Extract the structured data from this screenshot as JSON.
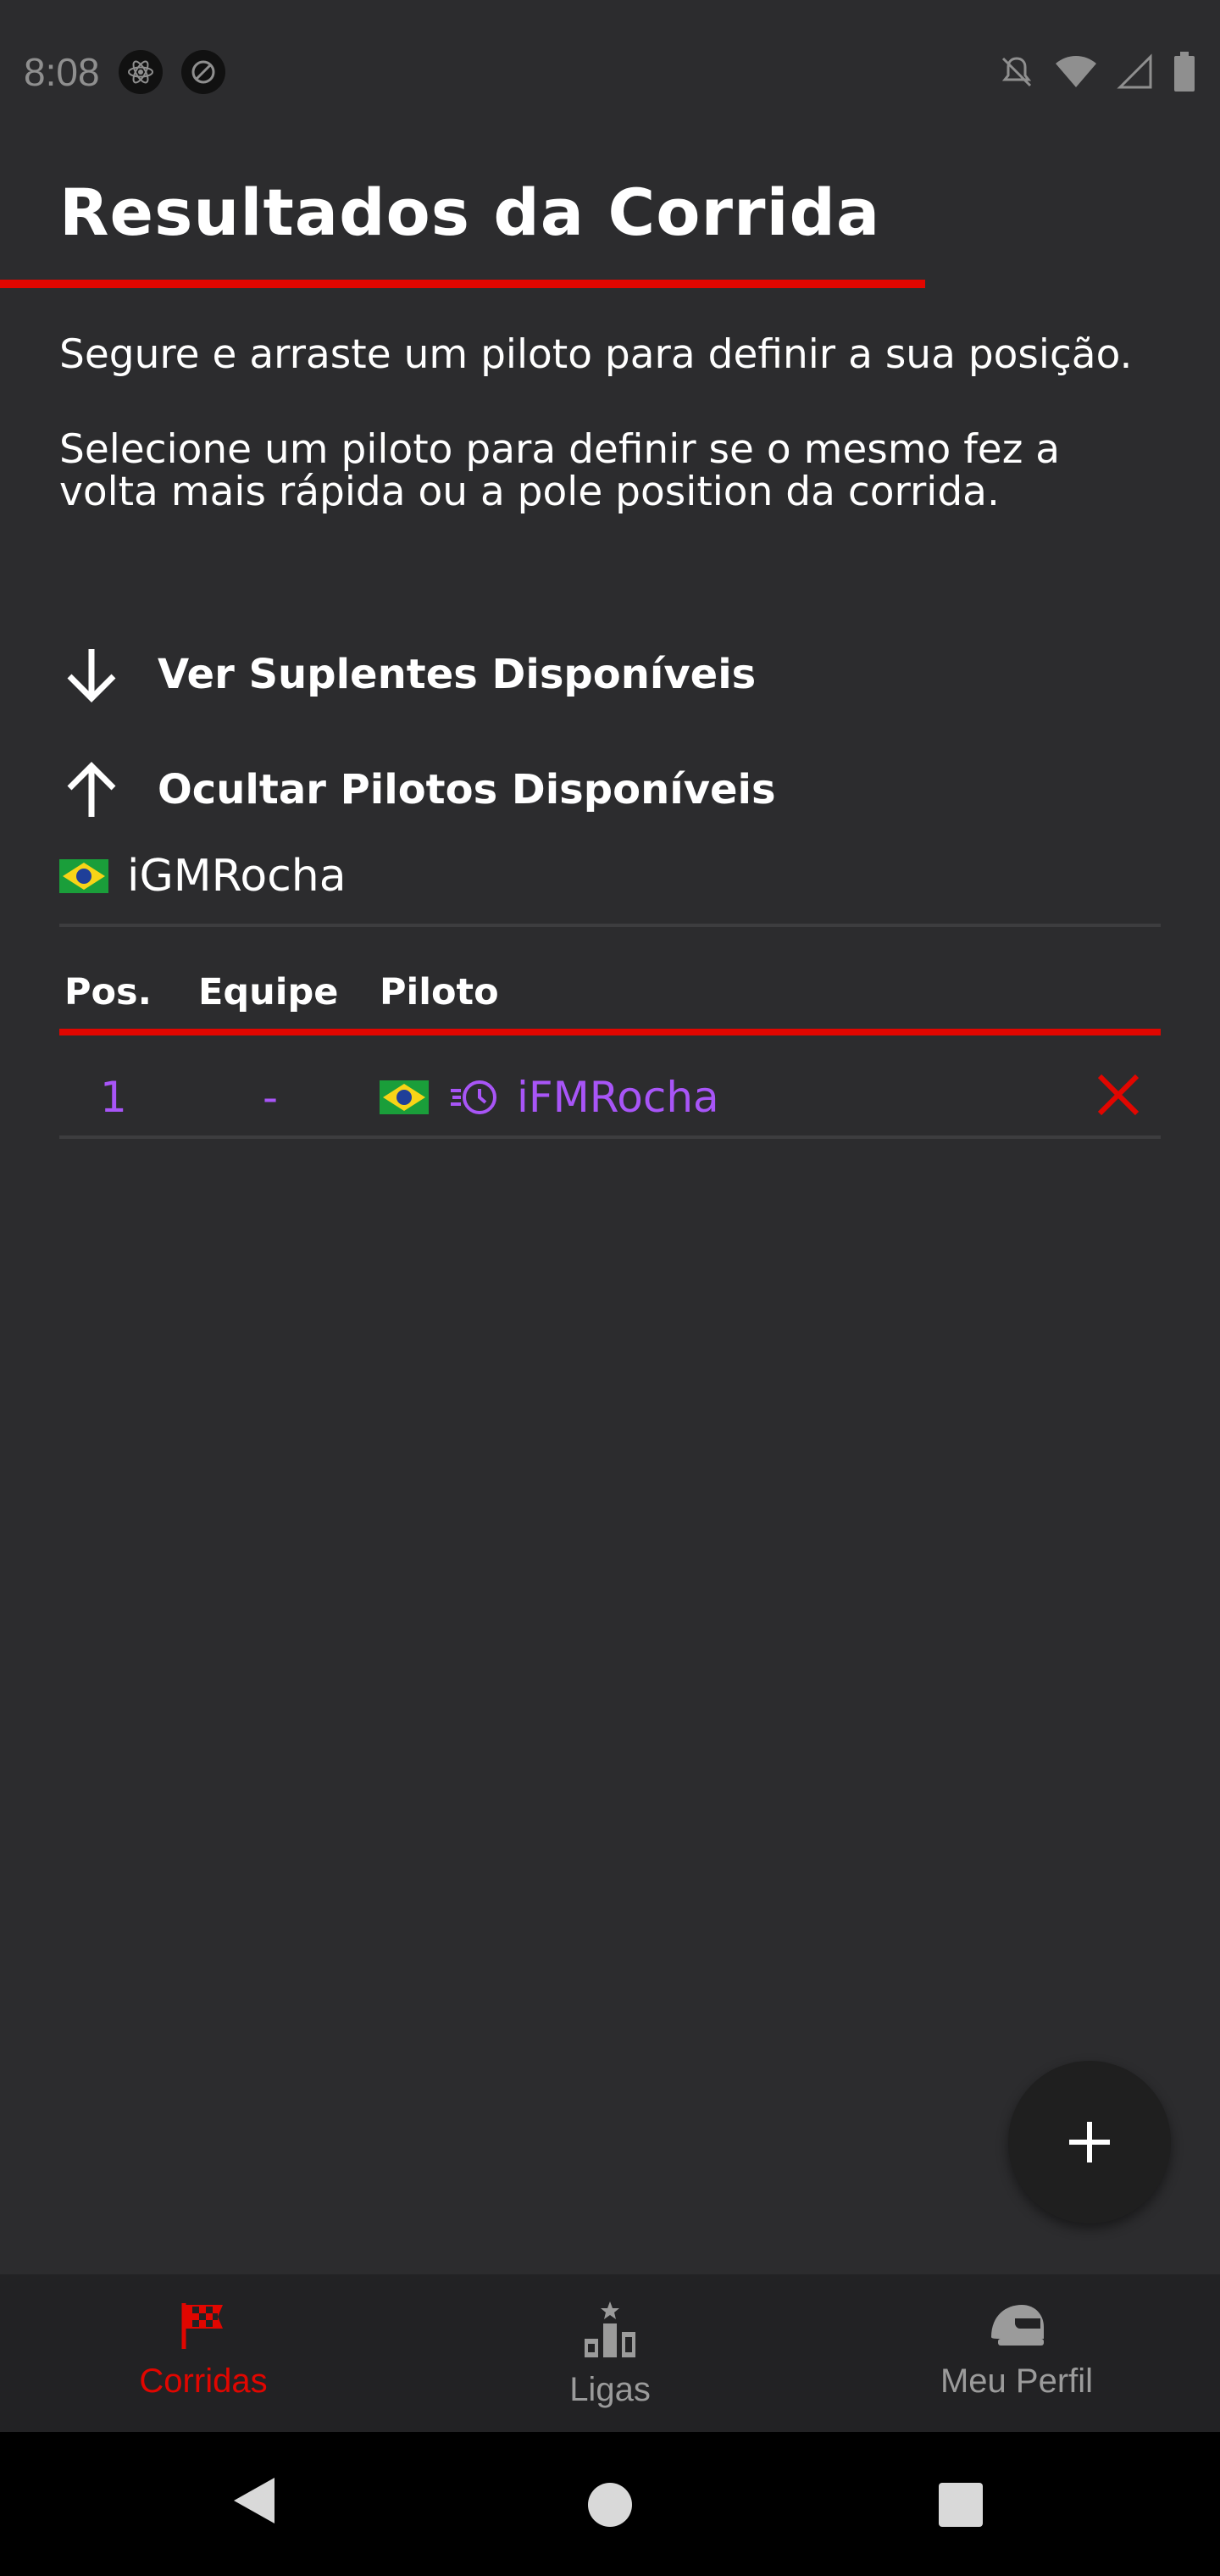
{
  "status_bar": {
    "time": "8:08"
  },
  "header": {
    "title": "Resultados da Corrida"
  },
  "instructions": {
    "line1": "Segure e arraste um piloto para definir a sua posição.",
    "line2": "Selecione um piloto para definir se o mesmo fez a volta mais rápida ou a pole position da corrida."
  },
  "toggles": {
    "substitutes_label": "Ver Suplentes Disponíveis",
    "available_label": "Ocultar Pilotos Disponíveis"
  },
  "available_drivers": [
    {
      "name": "iGMRocha",
      "flag": "brazil-flag"
    }
  ],
  "results_table": {
    "headers": {
      "pos": "Pos.",
      "team": "Equipe",
      "driver": "Piloto"
    },
    "rows": [
      {
        "pos": "1",
        "team": "-",
        "driver": "iFMRocha",
        "flag": "brazil-flag",
        "badge_icon": "fastest-lap-icon"
      }
    ]
  },
  "fab": {
    "icon": "plus-icon"
  },
  "bottom_nav": {
    "items": [
      {
        "label": "Corridas",
        "icon": "checkered-flag-icon",
        "active": true
      },
      {
        "label": "Ligas",
        "icon": "podium-icon",
        "active": false
      },
      {
        "label": "Meu Perfil",
        "icon": "helmet-icon",
        "active": false
      }
    ]
  },
  "colors": {
    "background": "#2c2c2e",
    "accent": "#e10600",
    "highlight": "#a855f7",
    "nav_background": "#222224",
    "inactive": "#9b9b9b"
  }
}
